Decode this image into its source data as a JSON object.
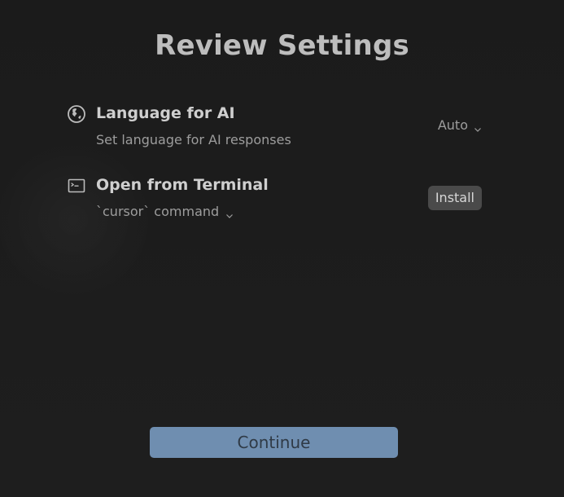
{
  "page": {
    "title": "Review Settings"
  },
  "settings": [
    {
      "icon": "globe-icon",
      "title": "Language for AI",
      "subtitle": "Set language for AI responses",
      "control": {
        "type": "dropdown",
        "value": "Auto"
      }
    },
    {
      "icon": "terminal-icon",
      "title": "Open from Terminal",
      "subtitle": "`cursor` command",
      "control": {
        "type": "button",
        "label": "Install"
      }
    }
  ],
  "actions": {
    "continue_label": "Continue"
  },
  "colors": {
    "background": "#1d1d1d",
    "title": "#bdbdbd",
    "text_primary": "#cfcfcf",
    "text_secondary": "#9d9d9d",
    "install_button": "#4a4a4a",
    "continue_button": "#6f8eb0"
  }
}
